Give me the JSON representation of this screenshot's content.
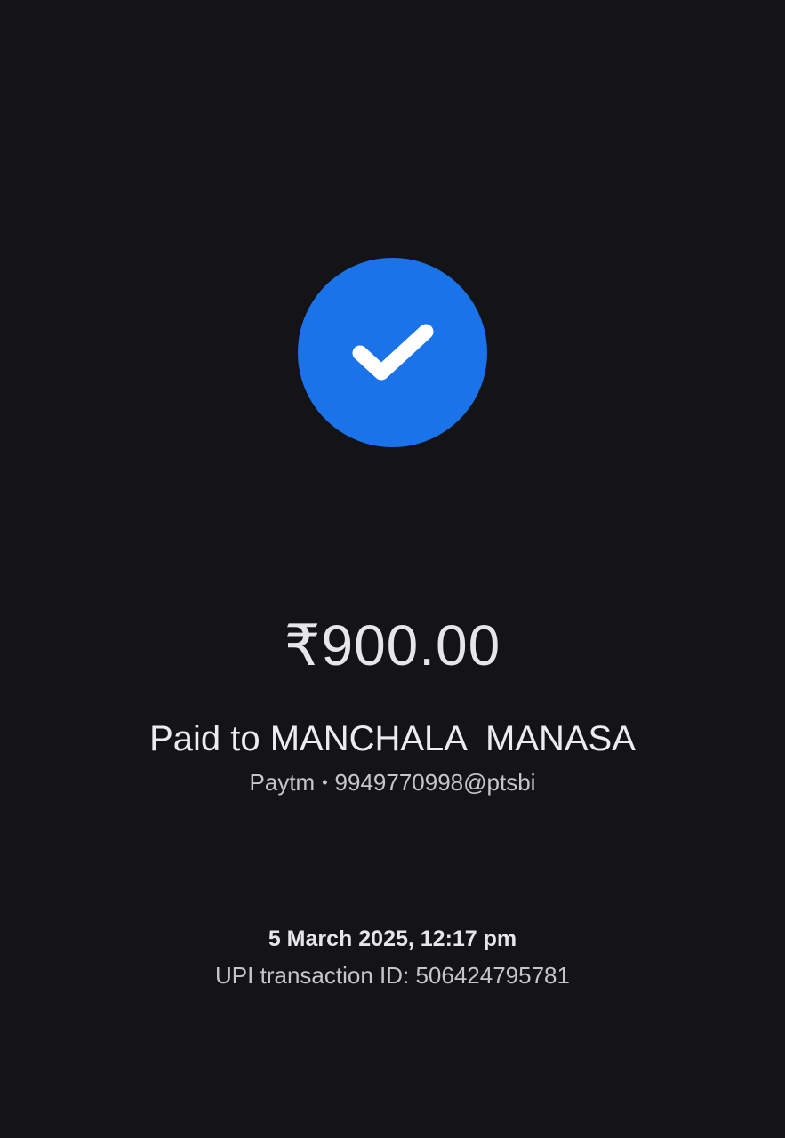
{
  "payment": {
    "amount": "₹900.00",
    "paid_to": "Paid to MANCHALA  MANASA",
    "provider": "Paytm",
    "separator": "•",
    "upi_id": "9949770998@ptsbi",
    "datetime": "5 March 2025, 12:17 pm",
    "transaction_id": "UPI transaction ID: 506424795781"
  },
  "status": {
    "icon": "check-icon",
    "color": "#1a73e8"
  },
  "theme": {
    "background": "#141416",
    "text_primary": "#e8e8ea",
    "text_secondary": "#c4c6c8"
  }
}
